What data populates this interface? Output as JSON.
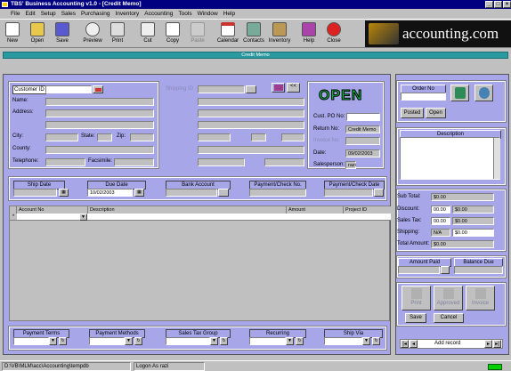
{
  "window": {
    "title": "TBS' Business Accounting v1.0 - [Credit Memo]",
    "min": "_",
    "max": "□",
    "close": "×"
  },
  "menu": [
    "File",
    "Edit",
    "Setup",
    "Sales",
    "Purchasing",
    "Inventory",
    "Accounting",
    "Tools",
    "Window",
    "Help"
  ],
  "toolbar": {
    "new": "New",
    "open": "Open",
    "save": "Save",
    "preview": "Preview",
    "print": "Print",
    "cut": "Cut",
    "copy": "Copy",
    "paste": "Paste",
    "calendar": "Calendar",
    "contacts": "Contacts",
    "inventory": "Inventory",
    "help": "Help",
    "close": "Close"
  },
  "banner": "accounting.com",
  "doc_title": "Credit Memo",
  "customer": {
    "customer_id_label": "Customer ID",
    "name_label": "Name:",
    "address_label": "Address:",
    "city_label": "City:",
    "state_label": "State:",
    "zip_label": "Zip:",
    "county_label": "County:",
    "telephone_label": "Telephone:",
    "facsimile_label": "Facsimile:"
  },
  "shipto": {
    "label": "Shipping ID",
    "back": "<<"
  },
  "status_word": "OPEN",
  "info": {
    "cust_po_label": "Cust. PO No:",
    "return_label": "Return No:",
    "return_value": "Credit Memo",
    "invoice_label": "Invoice No:",
    "date_label": "Date:",
    "date_value": "09/02/2003",
    "salesperson_label": "Salesperson:",
    "salesperson_value": "razi"
  },
  "terms_row": {
    "ship_date": "Ship Date",
    "due_date": "Due Date",
    "due_date_value": "10/02/2003",
    "bank_account": "Bank Account",
    "payment_check_no": "Payment/Check No.",
    "payment_check_date": "Payment/Check Date"
  },
  "grid": {
    "columns": [
      "Account No",
      "Description",
      "Amount",
      "Project ID"
    ],
    "row_marker": "*"
  },
  "bottom_row": {
    "payment_terms": "Payment Terms",
    "payment_methods": "Payment Methods",
    "sales_tax_group": "Sales Tax Group",
    "recurring": "Recurring",
    "ship_via": "Ship Via"
  },
  "order": {
    "label": "Order No",
    "posted": "Posted",
    "open": "Open"
  },
  "description_label": "Description",
  "totals": {
    "sub_total_label": "Sub Total:",
    "sub_total": "$0.00",
    "discount_label": "Discount:",
    "discount_pct": "00.00",
    "discount": "$0.00",
    "sales_tax_label": "Sales Tax:",
    "sales_tax_pct": "00.00",
    "sales_tax": "$0.00",
    "shipping_label": "Shipping:",
    "shipping_na": "N/A",
    "shipping": "$0.00",
    "total_label": "Total Amount:",
    "total": "$0.00"
  },
  "amount_paid_label": "Amount Paid",
  "balance_due_label": "Balance Due",
  "actions": {
    "print": "Print",
    "approved": "Approved",
    "invoice": "Invoice",
    "save": "Save",
    "cancel": "Cancel"
  },
  "nav": {
    "label": "Add record"
  },
  "statusbar": {
    "path": "D:\\VB\\MLM\\acc\\Accounting\\tempdb",
    "user": "Logon As razi"
  }
}
